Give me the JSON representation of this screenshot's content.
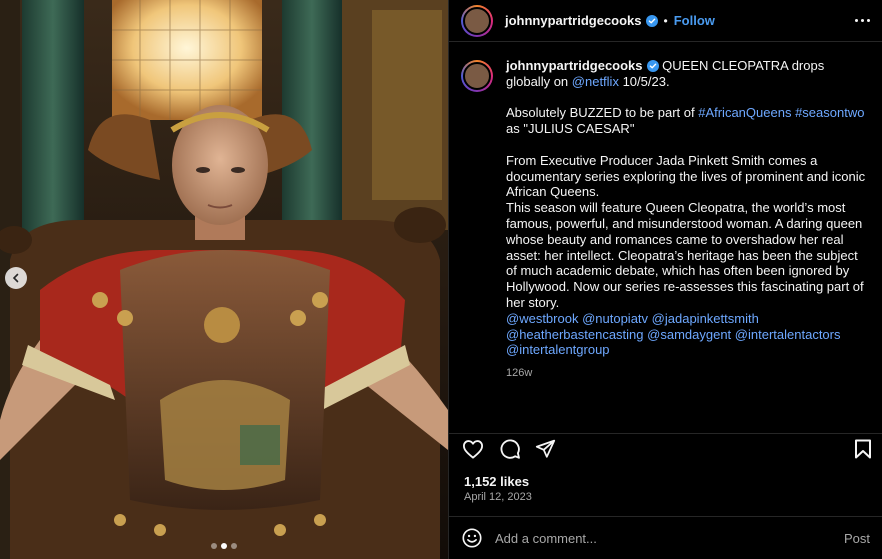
{
  "post": {
    "username": "johnnypartridgecooks",
    "separator": "•",
    "follow_label": "Follow",
    "image_alt": "Man dressed as Julius Caesar seated on a throne"
  },
  "caption": {
    "username": "johnnypartridgecooks",
    "p1_text": "QUEEN CLEOPATRA drops globally on",
    "p1_link": "@netflix",
    "p1_tail": "10/5/23.",
    "p2_text": "Absolutely BUZZED to be part of",
    "p2_tag1": "#AfricanQueens",
    "p2_tag2": "#seasontwo",
    "p2_tail": "as \"JULIUS CAESAR\"",
    "p3": "From Executive Producer Jada Pinkett Smith comes a documentary series exploring the lives of prominent and iconic African Queens.",
    "p4": "This season will feature Queen Cleopatra, the world’s most famous, powerful, and misunderstood woman. A daring queen whose beauty and romances came to overshadow her real asset: her intellect. Cleopatra’s heritage has been the subject of much academic debate, which has often been ignored by Hollywood. Now our series re-assesses this fascinating part of her story.",
    "mentions": [
      "@westbrook",
      "@nutopiatv",
      "@jadapinkettsmith",
      "@heatherbastencasting",
      "@samdaygent",
      "@intertalentactors",
      "@intertalentgroup"
    ],
    "age": "126w"
  },
  "stats": {
    "likes": "1,152 likes",
    "date": "April 12, 2023"
  },
  "comment": {
    "placeholder": "Add a comment...",
    "post_label": "Post"
  },
  "icons": {
    "like": "heart-icon",
    "comment": "speech-bubble-icon",
    "share": "paper-plane-icon",
    "save": "bookmark-icon",
    "emoji": "smiley-icon",
    "prev": "chevron-left-icon",
    "more": "ellipsis-icon",
    "verified": "verified-badge-icon"
  },
  "colors": {
    "link": "#6ea8ff",
    "follow": "#4a9bf0",
    "verified": "#3897f0",
    "background": "#000000"
  },
  "carousel": {
    "total": 3,
    "active": 2
  }
}
